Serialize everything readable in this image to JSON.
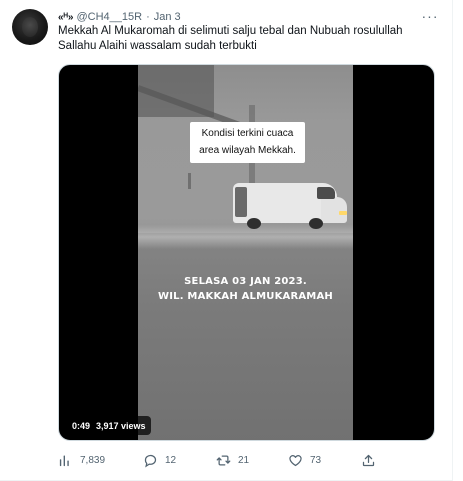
{
  "tweet": {
    "display_name": "«ᴴ»",
    "handle": "@CH4__15R",
    "separator": "·",
    "date": "Jan 3",
    "more_label": "···",
    "text": "Mekkah Al Mukaromah di selimuti salju tebal dan Nubuah rosulullah Sallahu Alaihi wassalam sudah terbukti"
  },
  "video": {
    "caption_line1": "Kondisi terkini cuaca",
    "caption_line2": "area wilayah Mekkah.",
    "overlay_line1": "SELASA 03 JAN 2023.",
    "overlay_line2": "WIL. MAKKAH ALMUKARAMAH",
    "duration": "0:49",
    "views": "3,917 views"
  },
  "actions": {
    "views_count": "7,839",
    "reply_count": "12",
    "retweet_count": "21",
    "like_count": "73"
  },
  "icons": {
    "views": "bar-chart-icon",
    "reply": "speech-bubble-icon",
    "retweet": "retweet-arrows-icon",
    "like": "heart-icon",
    "share": "upload-arrow-icon",
    "more": "more-dots-icon"
  },
  "colors": {
    "text_primary": "#0f1419",
    "text_secondary": "#536471",
    "border": "#eff3f4"
  }
}
